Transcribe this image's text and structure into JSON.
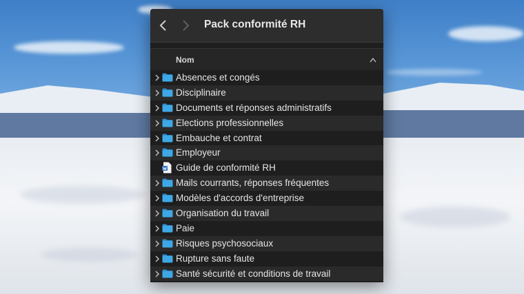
{
  "window": {
    "title": "Pack conformité RH",
    "back_icon": "chevron-left-icon",
    "forward_icon": "chevron-right-icon"
  },
  "list_header": {
    "name_column": "Nom",
    "sort_icon": "chevron-up-icon"
  },
  "items": [
    {
      "label": "Absences et congés",
      "kind": "folder"
    },
    {
      "label": "Disciplinaire",
      "kind": "folder"
    },
    {
      "label": "Documents et réponses administratifs",
      "kind": "folder"
    },
    {
      "label": "Elections professionnelles",
      "kind": "folder"
    },
    {
      "label": "Embauche et contrat",
      "kind": "folder"
    },
    {
      "label": "Employeur",
      "kind": "folder"
    },
    {
      "label": "Guide de conformité RH",
      "kind": "word-document"
    },
    {
      "label": "Mails courrants, réponses fréquentes",
      "kind": "folder"
    },
    {
      "label": "Modèles d'accords d'entreprise",
      "kind": "folder"
    },
    {
      "label": "Organisation du travail",
      "kind": "folder"
    },
    {
      "label": "Paie",
      "kind": "folder"
    },
    {
      "label": "Risques psychosociaux",
      "kind": "folder"
    },
    {
      "label": "Rupture sans faute",
      "kind": "folder"
    },
    {
      "label": "Santé sécurité et conditions de travail",
      "kind": "folder"
    }
  ],
  "colors": {
    "folder": "#3ea8e6",
    "window_bg": "#1e1e1e",
    "row_alt": "#2a2a2a",
    "text": "#e6e6e6"
  }
}
